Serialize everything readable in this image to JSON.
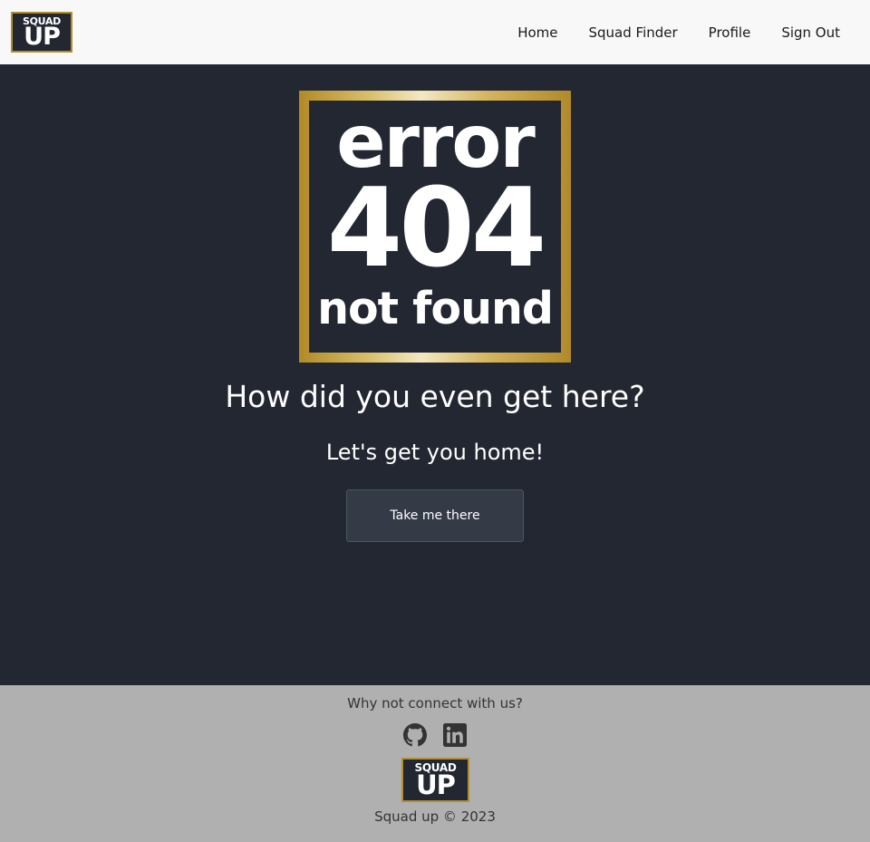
{
  "nav": {
    "logo_line1": "SQUAD",
    "logo_line2": "UP",
    "links": [
      {
        "label": "Home"
      },
      {
        "label": "Squad Finder"
      },
      {
        "label": "Profile"
      },
      {
        "label": "Sign Out"
      }
    ]
  },
  "main": {
    "error_image": {
      "line1": "error",
      "line2": "404",
      "line3": "not found"
    },
    "heading": "How did you even get here?",
    "subheading": "Let's get you home!",
    "button_label": "Take me there"
  },
  "footer": {
    "connect_text": "Why not connect with us?",
    "icons": [
      "github-icon",
      "linkedin-icon"
    ],
    "logo_line1": "SQUAD",
    "logo_line2": "UP",
    "copyright": "Squad up © 2023"
  },
  "colors": {
    "nav_bg": "#f8f8f8",
    "main_bg": "#222731",
    "footer_bg": "#b0b0b0",
    "gold_accent": "#c29d3a",
    "button_bg": "#343a46"
  }
}
